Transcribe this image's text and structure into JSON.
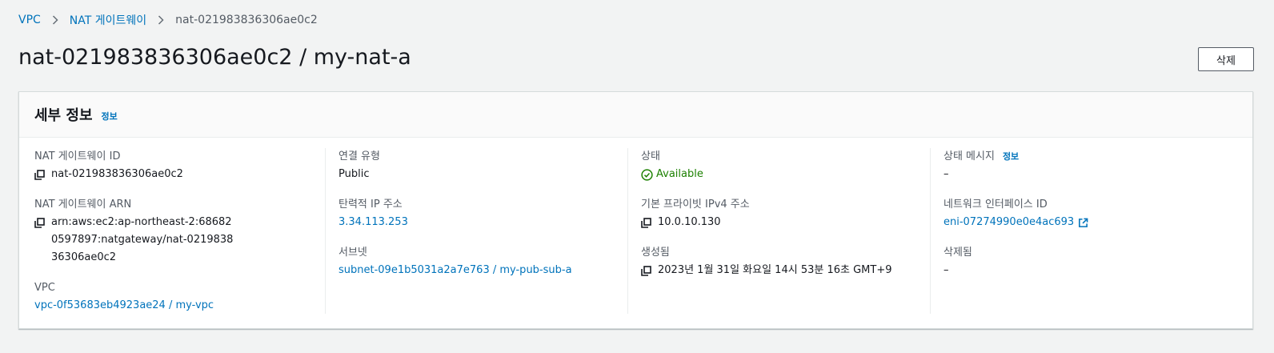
{
  "breadcrumb": {
    "items": [
      "VPC",
      "NAT 게이트웨이"
    ],
    "current": "nat-021983836306ae0c2"
  },
  "page": {
    "title": "nat-021983836306ae0c2 / my-nat-a",
    "delete_label": "삭제"
  },
  "panel": {
    "title": "세부 정보",
    "info_label": "정보"
  },
  "details": {
    "nat_id_label": "NAT 게이트웨이 ID",
    "nat_id_value": "nat-021983836306ae0c2",
    "nat_arn_label": "NAT 게이트웨이 ARN",
    "nat_arn_value": "arn:aws:ec2:ap-northeast-2:686820597897:natgateway/nat-021983836306ae0c2",
    "vpc_label": "VPC",
    "vpc_value": "vpc-0f53683eb4923ae24 / my-vpc",
    "conn_type_label": "연결 유형",
    "conn_type_value": "Public",
    "eip_label": "탄력적 IP 주소",
    "eip_value": "3.34.113.253",
    "subnet_label": "서브넷",
    "subnet_value": "subnet-09e1b5031a2a7e763 / my-pub-sub-a",
    "state_label": "상태",
    "state_value": "Available",
    "private_ip_label": "기본 프라이빗 IPv4 주소",
    "private_ip_value": "10.0.10.130",
    "created_label": "생성됨",
    "created_value": "2023년 1월 31일 화요일 14시 53분 16초 GMT+9",
    "state_msg_label": "상태 메시지",
    "state_msg_info": "정보",
    "state_msg_value": "–",
    "eni_label": "네트워크 인터페이스 ID",
    "eni_value": "eni-07274990e0e4ac693",
    "deleted_label": "삭제됨",
    "deleted_value": "–"
  },
  "colors": {
    "link": "#0073bb",
    "success": "#1d8102",
    "background": "#f2f3f3"
  },
  "icons": [
    "chevron-right-icon",
    "copy-icon",
    "status-success-icon",
    "external-link-icon"
  ]
}
